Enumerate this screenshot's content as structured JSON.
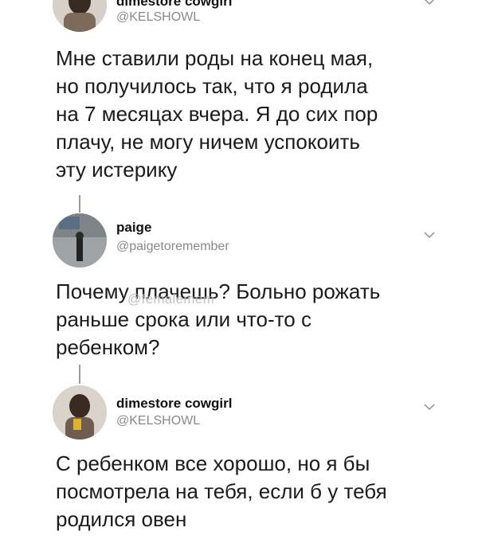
{
  "tweets": [
    {
      "name": "dimestore cowgirl",
      "handle": "@KELSHOWL",
      "text": "Мне ставили роды на конец мая,\nно получилось так, что я родила\nна 7 месяцах вчера. Я до сих пор\nплачу, не могу ничем успокоить\nэту истерику"
    },
    {
      "name": "paige",
      "handle": "@paigetoremember",
      "text": "Почему плачешь? Больно рожать\nраньше срока или что-то с\nребенком?"
    },
    {
      "name": "dimestore cowgirl",
      "handle": "@KELSHOWL",
      "text": "С ребенком все хорошо, но я бы\nпосмотрела на тебя, если б у тебя\nродился овен"
    }
  ],
  "watermark": "@femalemem",
  "icons": [
    "chevron-down-icon",
    "avatar"
  ]
}
